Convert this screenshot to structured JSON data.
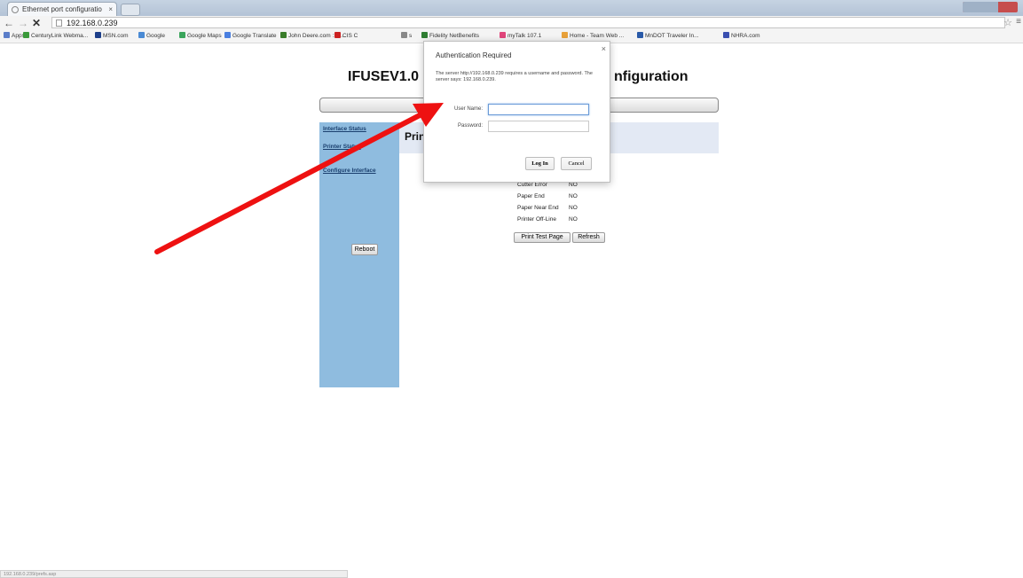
{
  "browser": {
    "tab_title": "Ethernet port configuratio",
    "tab_close": "×",
    "back": "←",
    "forward": "→",
    "stop": "✕",
    "url": "192.168.0.239",
    "star": "☆",
    "menu": "≡",
    "bookmarks": [
      {
        "label": "Apps",
        "color": "#5b7ec9"
      },
      {
        "label": "CenturyLink Webma...",
        "color": "#3a9a3a"
      },
      {
        "label": "MSN.com",
        "color": "#1d3f8a"
      },
      {
        "label": "Google",
        "color": "#4a8ad4"
      },
      {
        "label": "Google Maps",
        "color": "#3ba55c"
      },
      {
        "label": "Google Translate",
        "color": "#4a7fe0"
      },
      {
        "label": "John Deere.com :: S...",
        "color": "#3a7d2a"
      },
      {
        "label": "CIS C",
        "color": "#cc2222"
      },
      {
        "label": "s",
        "color": "#888888"
      },
      {
        "label": "Fidelity NetBenefits",
        "color": "#2e7d32"
      },
      {
        "label": "myTalk 107.1",
        "color": "#e0457b"
      },
      {
        "label": "Home - Team Web ...",
        "color": "#e8a13a"
      },
      {
        "label": "MnDOT Traveler In...",
        "color": "#2a5aa8"
      },
      {
        "label": "NHRA.com",
        "color": "#3a4fb0"
      }
    ],
    "status_url": "192.168.0.239/prefs.asp"
  },
  "page": {
    "title_left": "IFUSEV1.0 I",
    "title_right": "nfiguration",
    "heading": "Prin",
    "sidebar": {
      "links": [
        "Interface Status",
        "Printer Status",
        "Configure Interface"
      ],
      "reboot": "Reboot"
    },
    "status": [
      {
        "label": "Cutter Error",
        "value": "NO"
      },
      {
        "label": "Paper End",
        "value": "NO"
      },
      {
        "label": "Paper Near End",
        "value": "NO"
      },
      {
        "label": "Printer Off-Line",
        "value": "NO"
      }
    ],
    "buttons": {
      "print_test": "Print Test Page",
      "refresh": "Refresh"
    }
  },
  "dialog": {
    "title": "Authentication Required",
    "close": "×",
    "message": "The server http://192.168.0.239 requires a username and password. The server says: 192.168.0.239.",
    "username_label": "User Name:",
    "password_label": "Password:",
    "username_value": "",
    "password_value": "",
    "login": "Log In",
    "cancel": "Cancel"
  },
  "annotation": {
    "arrow_color": "#ee1111"
  }
}
